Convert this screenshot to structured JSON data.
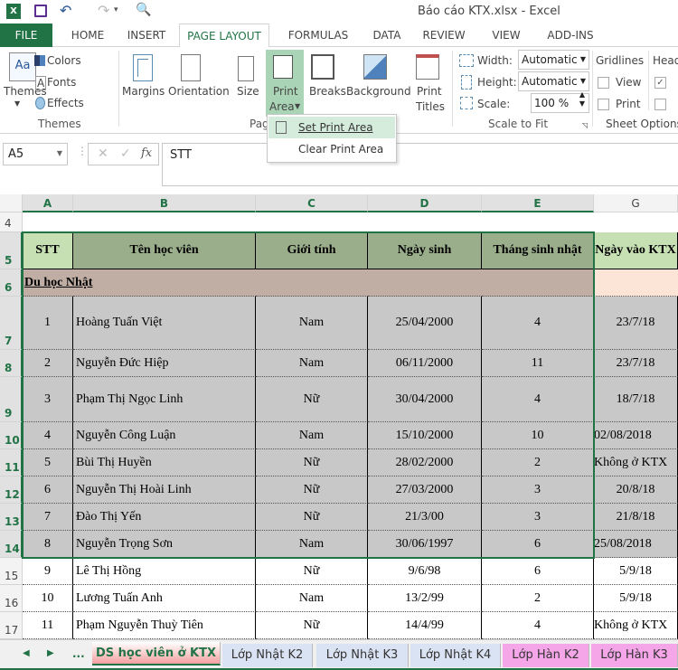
{
  "window": {
    "title": "Báo cáo KTX.xlsx - Excel"
  },
  "ribbon_tabs": [
    "FILE",
    "HOME",
    "INSERT",
    "PAGE LAYOUT",
    "FORMULAS",
    "DATA",
    "REVIEW",
    "VIEW",
    "ADD-INS"
  ],
  "active_tab": "PAGE LAYOUT",
  "ribbon": {
    "themes": "Themes",
    "colors": "Colors",
    "fonts": "Fonts",
    "effects": "Effects",
    "themes_group": "Themes",
    "margins": "Margins",
    "orientation": "Orientation",
    "size": "Size",
    "print_area_1": "Print",
    "print_area_2": "Area",
    "breaks": "Breaks",
    "background": "Background",
    "print_titles_1": "Print",
    "print_titles_2": "Titles",
    "page_setup_group": "Pag",
    "width_label": "Width:",
    "width_value": "Automatic",
    "height_label": "Height:",
    "height_value": "Automatic",
    "scale_label": "Scale:",
    "scale_value": "100 %",
    "scale_group": "Scale to Fit",
    "gridlines": "Gridlines",
    "headings": "Head",
    "view": "View",
    "print": "Print",
    "sheet_options_group": "Sheet Options",
    "gridlines_view": false,
    "gridlines_print": false,
    "headings_view": true,
    "headings_print": false
  },
  "print_area_menu": [
    "Set Print Area",
    "Clear Print Area"
  ],
  "formula_bar": {
    "name_box": "A5",
    "formula": "STT",
    "fx": "fx"
  },
  "columns": [
    "A",
    "B",
    "C",
    "D",
    "E",
    "G"
  ],
  "rows": [
    {
      "n": "4",
      "cells": [
        "",
        "",
        "",
        "",
        "",
        ""
      ]
    },
    {
      "n": "5",
      "cells": [
        "STT",
        "Tên học viên",
        "Giới tính",
        "Ngày sinh",
        "Tháng sinh nhật",
        "Ngày vào KTX"
      ]
    },
    {
      "n": "6",
      "cells": [
        "Du học Nhật",
        "",
        "",
        "",
        "",
        ""
      ]
    },
    {
      "n": "7",
      "cells": [
        "1",
        "Hoàng Tuấn Việt",
        "Nam",
        "25/04/2000",
        "4",
        "23/7/18"
      ]
    },
    {
      "n": "8",
      "cells": [
        "2",
        "Nguyễn Đức Hiệp",
        "Nam",
        "06/11/2000",
        "11",
        "23/7/18"
      ]
    },
    {
      "n": "9",
      "cells": [
        "3",
        "Phạm Thị Ngọc Linh",
        "Nữ",
        "30/04/2000",
        "4",
        "18/7/18"
      ]
    },
    {
      "n": "10",
      "cells": [
        "4",
        "Nguyễn Công Luận",
        "Nam",
        "15/10/2000",
        "10",
        "02/08/2018"
      ]
    },
    {
      "n": "11",
      "cells": [
        "5",
        "Bùi Thị Huyền",
        "Nữ",
        "28/02/2000",
        "2",
        "Không ở KTX"
      ]
    },
    {
      "n": "12",
      "cells": [
        "6",
        "Nguyễn Thị Hoài Linh",
        "Nữ",
        "27/03/2000",
        "3",
        "20/8/18"
      ]
    },
    {
      "n": "13",
      "cells": [
        "7",
        "Đào Thị Yến",
        "Nữ",
        "21/3/00",
        "3",
        "21/8/18"
      ]
    },
    {
      "n": "14",
      "cells": [
        "8",
        "Nguyễn Trọng Sơn",
        "Nam",
        "30/06/1997",
        "6",
        "25/08/2018"
      ]
    },
    {
      "n": "15",
      "cells": [
        "9",
        "Lê Thị Hồng",
        "Nữ",
        "9/6/98",
        "6",
        "5/9/18"
      ]
    },
    {
      "n": "16",
      "cells": [
        "10",
        "Lương Tuấn Anh",
        "Nam",
        "13/2/99",
        "2",
        "5/9/18"
      ]
    },
    {
      "n": "17",
      "cells": [
        "11",
        "Phạm Nguyễn Thuỳ Tiên",
        "Nữ",
        "14/4/99",
        "4",
        "Không ở KTX"
      ]
    }
  ],
  "sheet_tabs": [
    {
      "label": "DS học viên ở KTX",
      "color": "#f4a0a0",
      "active": true
    },
    {
      "label": "Lớp Nhật K2",
      "color": "#dae3f3"
    },
    {
      "label": "Lớp Nhật K3",
      "color": "#dae3f3"
    },
    {
      "label": "Lớp Nhật K4",
      "color": "#dae3f3"
    },
    {
      "label": "Lớp Hàn K2",
      "color": "#f4a6e8"
    },
    {
      "label": "Lớp Hàn K3",
      "color": "#f4a6e8"
    }
  ],
  "sheet_nav": {
    "more": "..."
  },
  "colors": {
    "accent": "#217346",
    "header_fill": "#9aae8c",
    "active_cell": "#c6e0b4",
    "group_fill": "#c0aea4",
    "selection": "#c8c8c8",
    "g_group_fill": "#fce4d6"
  }
}
